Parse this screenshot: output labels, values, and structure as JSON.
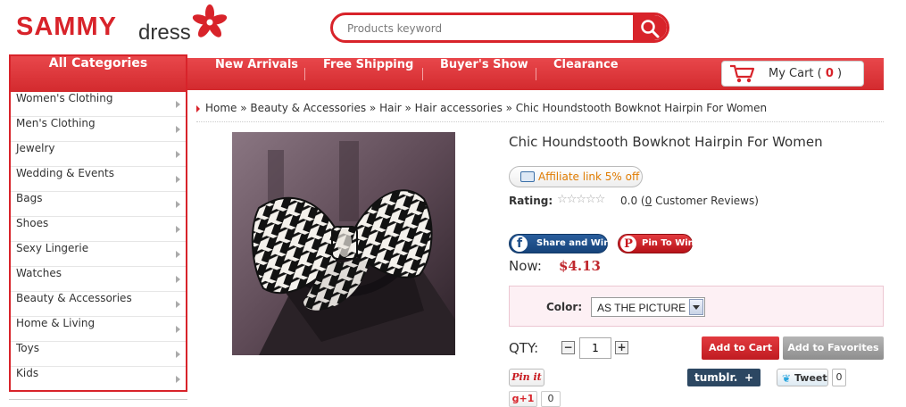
{
  "header": {
    "logo": {
      "brand": "SAMMY",
      "suffix": "dress"
    },
    "search": {
      "placeholder": "Products keyword"
    }
  },
  "nav": {
    "items": [
      "New Arrivals",
      "Free Shipping",
      "Buyer's Show",
      "Clearance"
    ],
    "cart": {
      "label": "My Cart ( ",
      "count": "0",
      "close": " )"
    }
  },
  "sidebar": {
    "title": "All Categories",
    "items": [
      "Women's Clothing",
      "Men's Clothing",
      "Jewelry",
      "Wedding & Events",
      "Bags",
      "Shoes",
      "Sexy Lingerie",
      "Watches",
      "Beauty & Accessories",
      "Home & Living",
      "Toys",
      "Kids"
    ]
  },
  "breadcrumb": "Home » Beauty & Accessories » Hair » Hair accessories » Chic Houndstooth Bowknot Hairpin For Women",
  "product": {
    "title": "Chic Houndstooth Bowknot Hairpin For Women",
    "affiliate": "Affiliate link 5% off",
    "rating_label": "Rating:",
    "stars": "☆☆☆☆☆",
    "rating_value": "0.0",
    "review_count": "0",
    "review_text": "Customer Reviews)",
    "share_label": "Share and Win",
    "pin_label": "Pin To Win",
    "price_label": "Now:",
    "price": "$4.13",
    "color_label": "Color:",
    "color_value": "AS THE PICTURE",
    "qty_label": "QTY:",
    "qty": "1",
    "add_to_cart": "Add to Cart",
    "add_to_favorites": "Add to Favorites"
  },
  "social": {
    "pinit": "Pin it",
    "tumblr": "tumblr.",
    "tumblr_plus": "+",
    "tweet": "Tweet",
    "tweet_count": "0",
    "gplus": "g+1",
    "gplus_count": "0"
  },
  "colors": {
    "brand_red": "#d8232a",
    "price_red": "#c0282e",
    "affiliate_orange": "#e07b00"
  }
}
